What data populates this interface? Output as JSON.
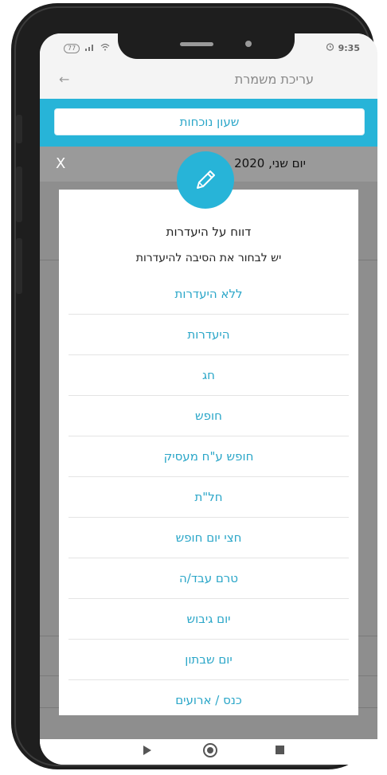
{
  "status_bar": {
    "battery_label": "77",
    "time": "9:35"
  },
  "app_bar": {
    "title": "עריכת משמרת"
  },
  "clock_button": {
    "label": "שעון נוכחות"
  },
  "date_bar": {
    "text": "יום שני, 2020",
    "close_label": "X"
  },
  "dialog": {
    "title": "דווח על היעדרות",
    "subtitle": "יש לבחור את הסיבה להיעדרות",
    "reasons": [
      "ללא היעדרות",
      "היעדרות",
      "חג",
      "חופש",
      "חופש ע\"ח מעסיק",
      "חל\"ת",
      "חצי יום חופש",
      "טרם עבד/ה",
      "יום גיבוש",
      "יום שבתון",
      "כנס / ארועים"
    ]
  },
  "colors": {
    "accent": "#27b4d8",
    "overlay_gray": "#9a9a9a",
    "link_text": "#2aa6c8"
  },
  "icons": {
    "badge": "pencil-icon"
  }
}
